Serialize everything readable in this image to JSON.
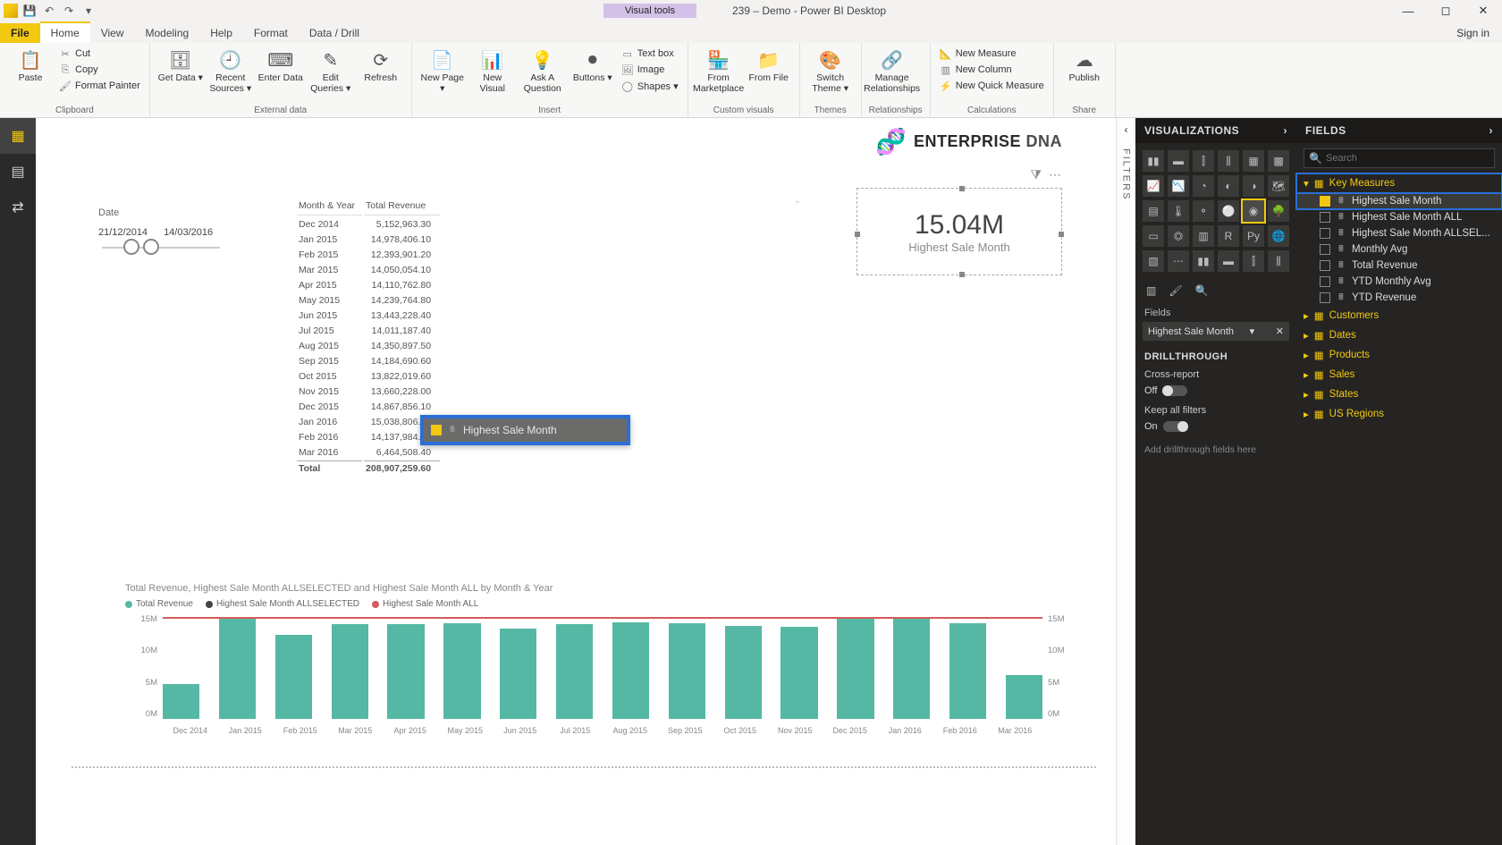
{
  "app": {
    "visual_tools_label": "Visual tools",
    "doc_title": "239 – Demo - Power BI Desktop",
    "signin": "Sign in"
  },
  "qat": {
    "save": "💾",
    "undo": "↶",
    "redo": "↷"
  },
  "tabs": {
    "file": "File",
    "home": "Home",
    "view": "View",
    "modeling": "Modeling",
    "help": "Help",
    "format": "Format",
    "datadrill": "Data / Drill"
  },
  "ribbon": {
    "clipboard": {
      "label": "Clipboard",
      "paste": "Paste",
      "cut": "Cut",
      "copy": "Copy",
      "painter": "Format Painter"
    },
    "external": {
      "label": "External data",
      "getdata": "Get Data ▾",
      "recent": "Recent Sources ▾",
      "enter": "Enter Data",
      "edit": "Edit Queries ▾",
      "refresh": "Refresh"
    },
    "insert": {
      "label": "Insert",
      "newpage": "New Page ▾",
      "newvisual": "New Visual",
      "ask": "Ask A Question",
      "buttons": "Buttons ▾",
      "textbox": "Text box",
      "image": "Image",
      "shapes": "Shapes ▾"
    },
    "custom": {
      "label": "Custom visuals",
      "marketplace": "From Marketplace",
      "file": "From File"
    },
    "themes": {
      "label": "Themes",
      "switch": "Switch Theme ▾"
    },
    "relationships": {
      "label": "Relationships",
      "manage": "Manage Relationships"
    },
    "calc": {
      "label": "Calculations",
      "measure": "New Measure",
      "column": "New Column",
      "quick": "New Quick Measure"
    },
    "share": {
      "label": "Share",
      "publish": "Publish"
    }
  },
  "leftrail": {
    "report": "▦",
    "data": "▤",
    "model": "⇄"
  },
  "logo": {
    "brand_a": "ENTERPRISE",
    "brand_b": "DNA"
  },
  "card": {
    "value": "15.04M",
    "label": "Highest Sale Month"
  },
  "slicer": {
    "title": "Date",
    "from": "21/12/2014",
    "to": "14/03/2016"
  },
  "table_visual": {
    "col1": "Month & Year",
    "col2": "Total Revenue",
    "rows": [
      {
        "m": "Dec 2014",
        "v": "5,152,963.30"
      },
      {
        "m": "Jan 2015",
        "v": "14,978,406.10"
      },
      {
        "m": "Feb 2015",
        "v": "12,393,901.20"
      },
      {
        "m": "Mar 2015",
        "v": "14,050,054.10"
      },
      {
        "m": "Apr 2015",
        "v": "14,110,762.80"
      },
      {
        "m": "May 2015",
        "v": "14,239,764.80"
      },
      {
        "m": "Jun 2015",
        "v": "13,443,228.40"
      },
      {
        "m": "Jul 2015",
        "v": "14,011,187.40"
      },
      {
        "m": "Aug 2015",
        "v": "14,350,897.50"
      },
      {
        "m": "Sep 2015",
        "v": "14,184,690.60"
      },
      {
        "m": "Oct 2015",
        "v": "13,822,019.60"
      },
      {
        "m": "Nov 2015",
        "v": "13,660,228.00"
      },
      {
        "m": "Dec 2015",
        "v": "14,867,856.10"
      },
      {
        "m": "Jan 2016",
        "v": "15,038,806.60"
      },
      {
        "m": "Feb 2016",
        "v": "14,137,984.90"
      },
      {
        "m": "Mar 2016",
        "v": "6,464,508.40"
      }
    ],
    "total_lbl": "Total",
    "total_val": "208,907,259.60"
  },
  "drag": {
    "label": "Highest Sale Month"
  },
  "chart_data": {
    "type": "bar",
    "title": "Total Revenue, Highest Sale Month ALLSELECTED and Highest Sale Month ALL by Month & Year",
    "legend": [
      "Total Revenue",
      "Highest Sale Month ALLSELECTED",
      "Highest Sale Month ALL"
    ],
    "colors": {
      "bar": "#55b8a5",
      "line_allsel": "#444",
      "line_all": "#d45b5b"
    },
    "categories": [
      "Dec 2014",
      "Jan 2015",
      "Feb 2015",
      "Mar 2015",
      "Apr 2015",
      "May 2015",
      "Jun 2015",
      "Jul 2015",
      "Aug 2015",
      "Sep 2015",
      "Oct 2015",
      "Nov 2015",
      "Dec 2015",
      "Jan 2016",
      "Feb 2016",
      "Mar 2016"
    ],
    "series": [
      {
        "name": "Total Revenue",
        "values": [
          5.15,
          14.98,
          12.39,
          14.05,
          14.11,
          14.24,
          13.44,
          14.01,
          14.35,
          14.18,
          13.82,
          13.66,
          14.87,
          15.04,
          14.14,
          6.46
        ]
      },
      {
        "name": "Highest Sale Month ALLSELECTED",
        "values": [
          15.04,
          15.04,
          15.04,
          15.04,
          15.04,
          15.04,
          15.04,
          15.04,
          15.04,
          15.04,
          15.04,
          15.04,
          15.04,
          15.04,
          15.04,
          15.04
        ]
      },
      {
        "name": "Highest Sale Month ALL",
        "values": [
          15.04,
          15.04,
          15.04,
          15.04,
          15.04,
          15.04,
          15.04,
          15.04,
          15.04,
          15.04,
          15.04,
          15.04,
          15.04,
          15.04,
          15.04,
          15.04
        ]
      }
    ],
    "ylabel_left": "",
    "ylabel_right": "",
    "yticks_left": [
      "15M",
      "10M",
      "5M",
      "0M"
    ],
    "yticks_right": [
      "15M",
      "10M",
      "5M",
      "0M"
    ],
    "ylim": [
      0,
      15.5
    ]
  },
  "viz_pane": {
    "hdr": "VISUALIZATIONS",
    "fields_lbl": "Fields",
    "fieldwell_item": "Highest Sale Month",
    "drill_hdr": "DRILLTHROUGH",
    "cross": "Cross-report",
    "off": "Off",
    "keep": "Keep all filters",
    "on": "On",
    "hint": "Add drillthrough fields here"
  },
  "filters_rail": "FILTERS",
  "fields_pane": {
    "hdr": "FIELDS",
    "search_ph": "Search",
    "key_measures": "Key Measures",
    "measures": [
      {
        "name": "Highest Sale Month",
        "checked": true,
        "sel": true
      },
      {
        "name": "Highest Sale Month ALL",
        "checked": false
      },
      {
        "name": "Highest Sale Month ALLSEL...",
        "checked": false
      },
      {
        "name": "Monthly Avg",
        "checked": false
      },
      {
        "name": "Total Revenue",
        "checked": false
      },
      {
        "name": "YTD Monthly Avg",
        "checked": false
      },
      {
        "name": "YTD Revenue",
        "checked": false
      }
    ],
    "tables": [
      "Customers",
      "Dates",
      "Products",
      "Sales",
      "States",
      "US Regions"
    ]
  }
}
